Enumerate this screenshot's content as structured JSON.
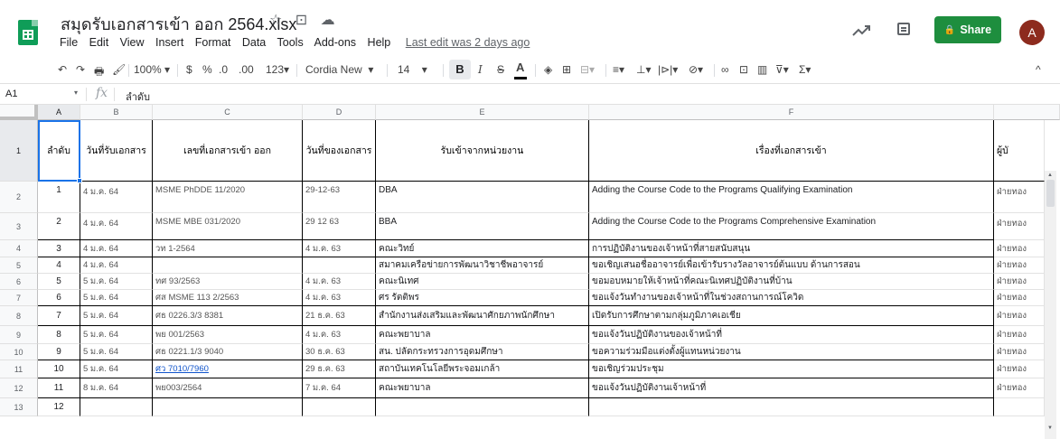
{
  "doc": {
    "title": "สมุดรับเอกสารเข้า ออก 2564.xlsx",
    "star_icon": "☆",
    "folder_icon": "⊡",
    "cloud_icon": "☁"
  },
  "menu": {
    "items": [
      "File",
      "Edit",
      "View",
      "Insert",
      "Format",
      "Data",
      "Tools",
      "Add-ons",
      "Help"
    ],
    "last_edit": "Last edit was 2 days ago"
  },
  "header_right": {
    "share_label": "Share",
    "share_icon": "🔒",
    "avatar_letter": "A",
    "accent": "#1e8e3e"
  },
  "toolbar": {
    "undo": "↶",
    "redo": "↷",
    "print": "🖶",
    "paint": "🖌",
    "zoom": "100%",
    "zoom_caret": "▾",
    "currency": "$",
    "percent": "%",
    "dec_less": ".0",
    "dec_more": ".00",
    "more_formats": "123▾",
    "font": "Cordia New",
    "font_caret": "▾",
    "size": "14",
    "size_caret": "▾",
    "bold": "B",
    "italic": "I",
    "strike": "S",
    "text_color": "A",
    "fill": "◈",
    "borders": "⊞",
    "merge": "⊟▾",
    "halign": "≡▾",
    "valign": "⊥▾",
    "wrap": "|⊳|▾",
    "rotate": "⊘▾",
    "link": "∞",
    "comment": "⊡",
    "chart": "▥",
    "filter": "⊽▾",
    "functions": "Σ▾",
    "collapse": "^"
  },
  "formula": {
    "cell_ref": "A1",
    "fx": "fx",
    "value": "ลำดับ"
  },
  "grid": {
    "columns": [
      "A",
      "B",
      "C",
      "D",
      "E",
      "F"
    ],
    "header_row": {
      "row_num": "1",
      "cells": [
        "ลำดับ",
        "วันที่รับเอกสาร",
        "เลขที่เอกสารเข้า ออก",
        "วันที่ของเอกสาร",
        "รับเข้าจากหน่วยงาน",
        "เรื่องที่เอกสารเข้า",
        "ผู้บั"
      ]
    },
    "rows": [
      {
        "n": "2",
        "a": "1",
        "b": "4 ม.ค. 64",
        "c": "MSME PhDDE 11/2020",
        "d": "29-12-63",
        "e": "DBA",
        "f": "Adding the Course Code to the Programs Qualifying Examination",
        "g": "ฝ่ายทอง"
      },
      {
        "n": "3",
        "a": "2",
        "b": "4 ม.ค. 64",
        "c": "MSME MBE 031/2020",
        "d": "29 12 63",
        "e": "BBA",
        "f": "Adding the Course Code to the Programs Comprehensive Examination",
        "g": "ฝ่ายทอง"
      },
      {
        "n": "4",
        "a": "3",
        "b": "4 ม.ค. 64",
        "c": "วท 1-2564",
        "d": "4 ม.ค. 63",
        "e": "คณะวิทย์",
        "f": "การปฏิบัติงานของเจ้าหน้าที่สายสนับสนุน",
        "g": "ฝ่ายทอง"
      },
      {
        "n": "5",
        "a": "4",
        "b": "4 ม.ค. 64",
        "c": "",
        "d": "",
        "e": "สมาคมเครือข่ายการพัฒนาวิชาชีพอาจารย์",
        "f": "ขอเชิญเสนอชื่ออาจารย์เพื่อเข้ารับรางวัลอาจารย์ต้นแบบ ด้านการสอน",
        "g": "ฝ่ายทอง"
      },
      {
        "n": "6",
        "a": "5",
        "b": "5 ม.ค. 64",
        "c": "ทศ 93/2563",
        "d": "4 ม.ค. 63",
        "e": "คณะนิเทศ",
        "f": "ขอมอบหมายให้เจ้าหน้าที่คณะนิเทศปฏิบัติงานที่บ้าน",
        "g": "ฝ่ายทอง"
      },
      {
        "n": "7",
        "a": "6",
        "b": "5 ม.ค. 64",
        "c": "ศส MSME 113 2/2563",
        "d": "4 ม.ค. 63",
        "e": "ศร รัตติพร",
        "f": "ขอแจ้งวันทำงานของเจ้าหน้าที่ในช่วงสถานการณ์โควิด",
        "g": "ฝ่ายทอง"
      },
      {
        "n": "8",
        "a": "7",
        "b": "5 ม.ค. 64",
        "c": "ศธ 0226.3/3 8381",
        "d": "21 ธ.ค. 63",
        "e": "สำนักงานส่งเสริมและพัฒนาศักยภาพนักศึกษา",
        "f": "เปิดรับการศึกษาตามกลุ่มภูมิภาคเอเชีย",
        "g": "ฝ่ายทอง"
      },
      {
        "n": "9",
        "a": "8",
        "b": "5 ม.ค. 64",
        "c": "พย 001/2563",
        "d": "4 ม.ค. 63",
        "e": "คณะพยาบาล",
        "f": "ขอแจ้งวันปฏิบัติงานของเจ้าหน้าที่",
        "g": "ฝ่ายทอง"
      },
      {
        "n": "10",
        "a": "9",
        "b": "5 ม.ค. 64",
        "c": "ศธ 0221.1/3 9040",
        "d": "30 ธ.ค. 63",
        "e": "สน. ปลัดกระทรวงการอุดมศึกษา",
        "f": "ขอความร่วมมือแต่งตั้งผู้แทนหน่วยงาน",
        "g": "ฝ่ายทอง"
      },
      {
        "n": "11",
        "a": "10",
        "b": "5 ม.ค. 64",
        "c": "ศว 7010/7960",
        "d": "29 ธ.ค. 63",
        "e": "สถาบันเทคโนโลยีพระจอมเกล้า",
        "f": "ขอเชิญร่วมประชุม",
        "g": "ฝ่ายทอง"
      },
      {
        "n": "12",
        "a": "11",
        "b": "8 ม.ค. 64",
        "c": "พย003/2564",
        "d": "7 ม.ค. 64",
        "e": "คณะพยาบาล",
        "f": "ขอแจ้งวันปฏิบัติงานเจ้าหน้าที่",
        "g": "ฝ่ายทอง"
      },
      {
        "n": "13",
        "a": "12",
        "b": "",
        "c": "",
        "d": "",
        "e": "",
        "f": "",
        "g": ""
      }
    ]
  }
}
